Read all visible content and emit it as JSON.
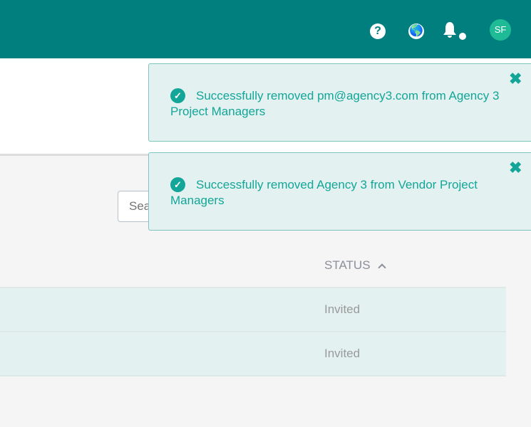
{
  "header": {
    "help_icon": "question-circle",
    "globe_icon": "globe",
    "notifications_icon": "bell",
    "avatar_initials": "SF",
    "color": "#017f7e"
  },
  "search": {
    "placeholder": "Search"
  },
  "table": {
    "columns": [
      {
        "label": "STATUS",
        "sort": "ascending"
      }
    ],
    "rows": [
      {
        "status": "Invited"
      },
      {
        "status": "Invited"
      }
    ]
  },
  "toasts": [
    {
      "message": "Successfully removed pm@agency3.com from Agency 3 Project Managers"
    },
    {
      "message": "Successfully removed Agency 3 from Vendor Project Managers"
    }
  ]
}
